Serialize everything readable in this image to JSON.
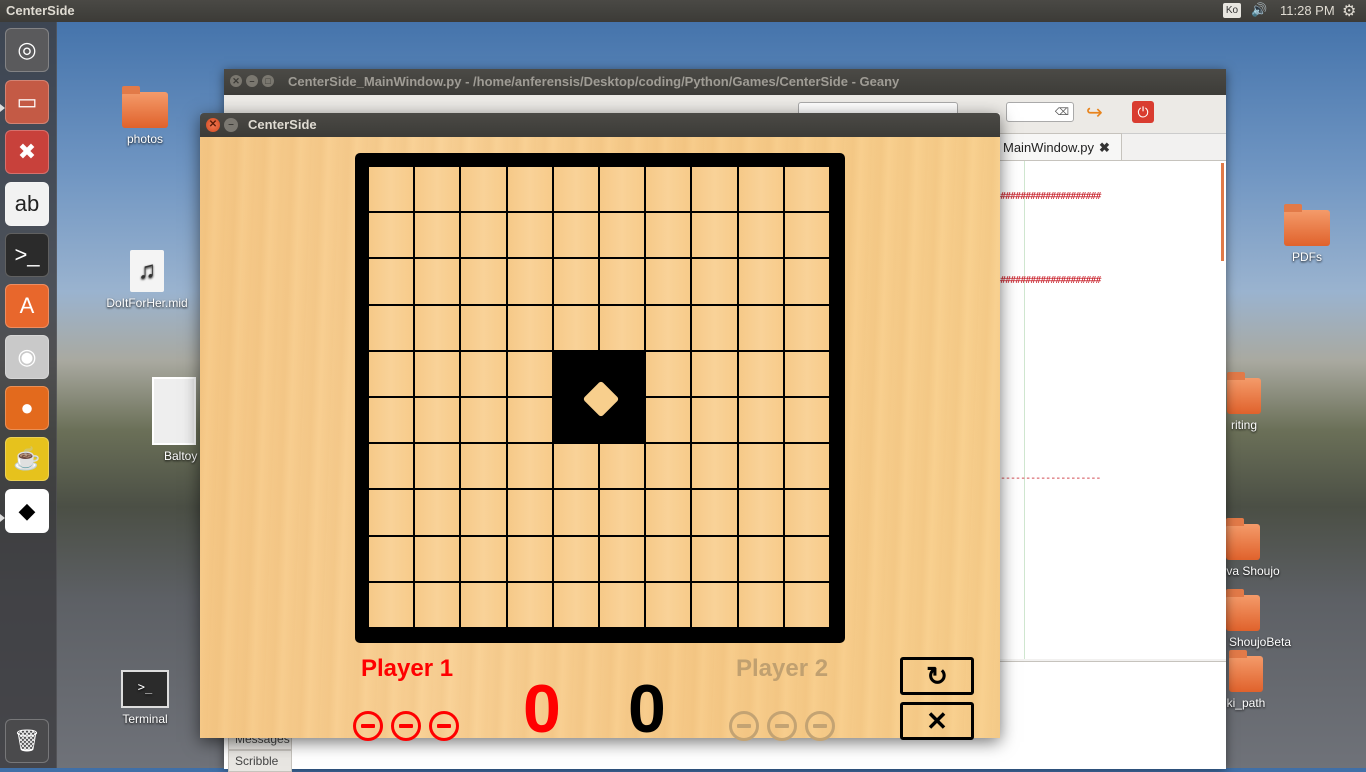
{
  "top_panel": {
    "app_title": "CenterSide",
    "keyboard_indicator": "Ko",
    "volume_icon": "volume-icon",
    "clock": "11:28 PM",
    "settings_icon": "gear-icon"
  },
  "launcher": {
    "items": [
      {
        "name": "dash-icon",
        "glyph": "◎",
        "color": "#5a5a5c"
      },
      {
        "name": "file-manager-icon",
        "glyph": "▭",
        "color": "#c45a45"
      },
      {
        "name": "system-settings-icon",
        "glyph": "✖",
        "color": "#c8413b"
      },
      {
        "name": "character-map-icon",
        "glyph": "ab",
        "color": "#f2f2f2"
      },
      {
        "name": "terminal-icon",
        "glyph": ">_",
        "color": "#2b2b2b"
      },
      {
        "name": "software-center-icon",
        "glyph": "A",
        "color": "#e8672c"
      },
      {
        "name": "camera-icon",
        "glyph": "◉",
        "color": "#c9c9c9"
      },
      {
        "name": "firefox-icon",
        "glyph": "●",
        "color": "#e36a1d"
      },
      {
        "name": "kettle-icon",
        "glyph": "☕",
        "color": "#e6c21d"
      },
      {
        "name": "centerside-app-icon",
        "glyph": "◆",
        "color": "#000000"
      },
      {
        "name": "trash-icon",
        "glyph": "🗑",
        "color": "#4a4a4c"
      }
    ]
  },
  "desktop": {
    "icons": [
      {
        "label": "photos",
        "type": "folder"
      },
      {
        "label": "DoItForHer.mid",
        "type": "audio"
      },
      {
        "label": "Baltoy",
        "type": "image"
      },
      {
        "label": "Terminal",
        "type": "terminal"
      },
      {
        "label": "PDFs",
        "type": "folder"
      },
      {
        "label": "riting",
        "type": "folder"
      },
      {
        "label": "va Shoujo",
        "type": "folder"
      },
      {
        "label": "ShoujoBeta",
        "type": "folder"
      },
      {
        "label": "ki_path",
        "type": "folder"
      }
    ]
  },
  "geany": {
    "title": "CenterSide_MainWindow.py - /home/anferensis/Desktop/coding/Python/Games/CenterSide - Geany",
    "tab_label": "MainWindow.py",
    "hash_line": "####################",
    "dash_line": "--------------------",
    "side_tabs": [
      "Messages",
      "Scribble"
    ]
  },
  "centerside": {
    "title": "CenterSide",
    "player1": {
      "label": "Player 1",
      "score": "0",
      "lives": 3,
      "color": "#ff0000"
    },
    "player2": {
      "label": "Player 2",
      "score": "0",
      "lives": 3,
      "color": "#c0a070"
    },
    "restart_icon": "↻",
    "quit_icon": "✕",
    "board_size": 10
  }
}
